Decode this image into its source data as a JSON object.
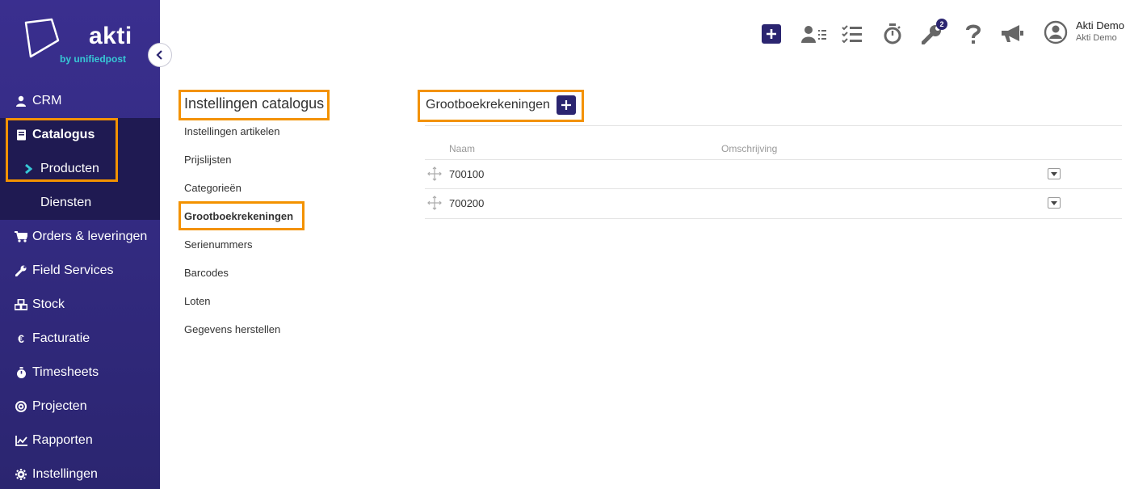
{
  "brand": {
    "name": "akti",
    "sub": "by unifiedpost",
    "accent": "#2b2570",
    "highlight": "#f39200",
    "sub_color": "#37c8d6"
  },
  "sidebar": {
    "items": [
      {
        "label": "CRM",
        "icon": "user-icon"
      },
      {
        "label": "Catalogus",
        "icon": "book-icon"
      },
      {
        "label": "Orders & leveringen",
        "icon": "cart-icon"
      },
      {
        "label": "Field Services",
        "icon": "wrench-icon"
      },
      {
        "label": "Stock",
        "icon": "cubes-icon"
      },
      {
        "label": "Facturatie",
        "icon": "euro-icon"
      },
      {
        "label": "Timesheets",
        "icon": "stopwatch-icon"
      },
      {
        "label": "Projecten",
        "icon": "target-icon"
      },
      {
        "label": "Rapporten",
        "icon": "chart-icon"
      },
      {
        "label": "Instellingen",
        "icon": "gear-icon"
      }
    ],
    "catalogus_sub": [
      {
        "label": "Producten"
      },
      {
        "label": "Diensten"
      }
    ]
  },
  "topbar": {
    "notification_count": "2",
    "user_name": "Akti Demo",
    "user_company": "Akti Demo"
  },
  "settings_nav": {
    "title": "Instellingen catalogus",
    "links": [
      "Instellingen artikelen",
      "Prijslijsten",
      "Categorieën",
      "Grootboekrekeningen",
      "Serienummers",
      "Barcodes",
      "Loten",
      "Gegevens herstellen"
    ]
  },
  "main": {
    "title": "Grootboekrekeningen",
    "columns": [
      "Naam",
      "Omschrijving"
    ],
    "rows": [
      {
        "name": "700100",
        "description": ""
      },
      {
        "name": "700200",
        "description": ""
      }
    ]
  }
}
